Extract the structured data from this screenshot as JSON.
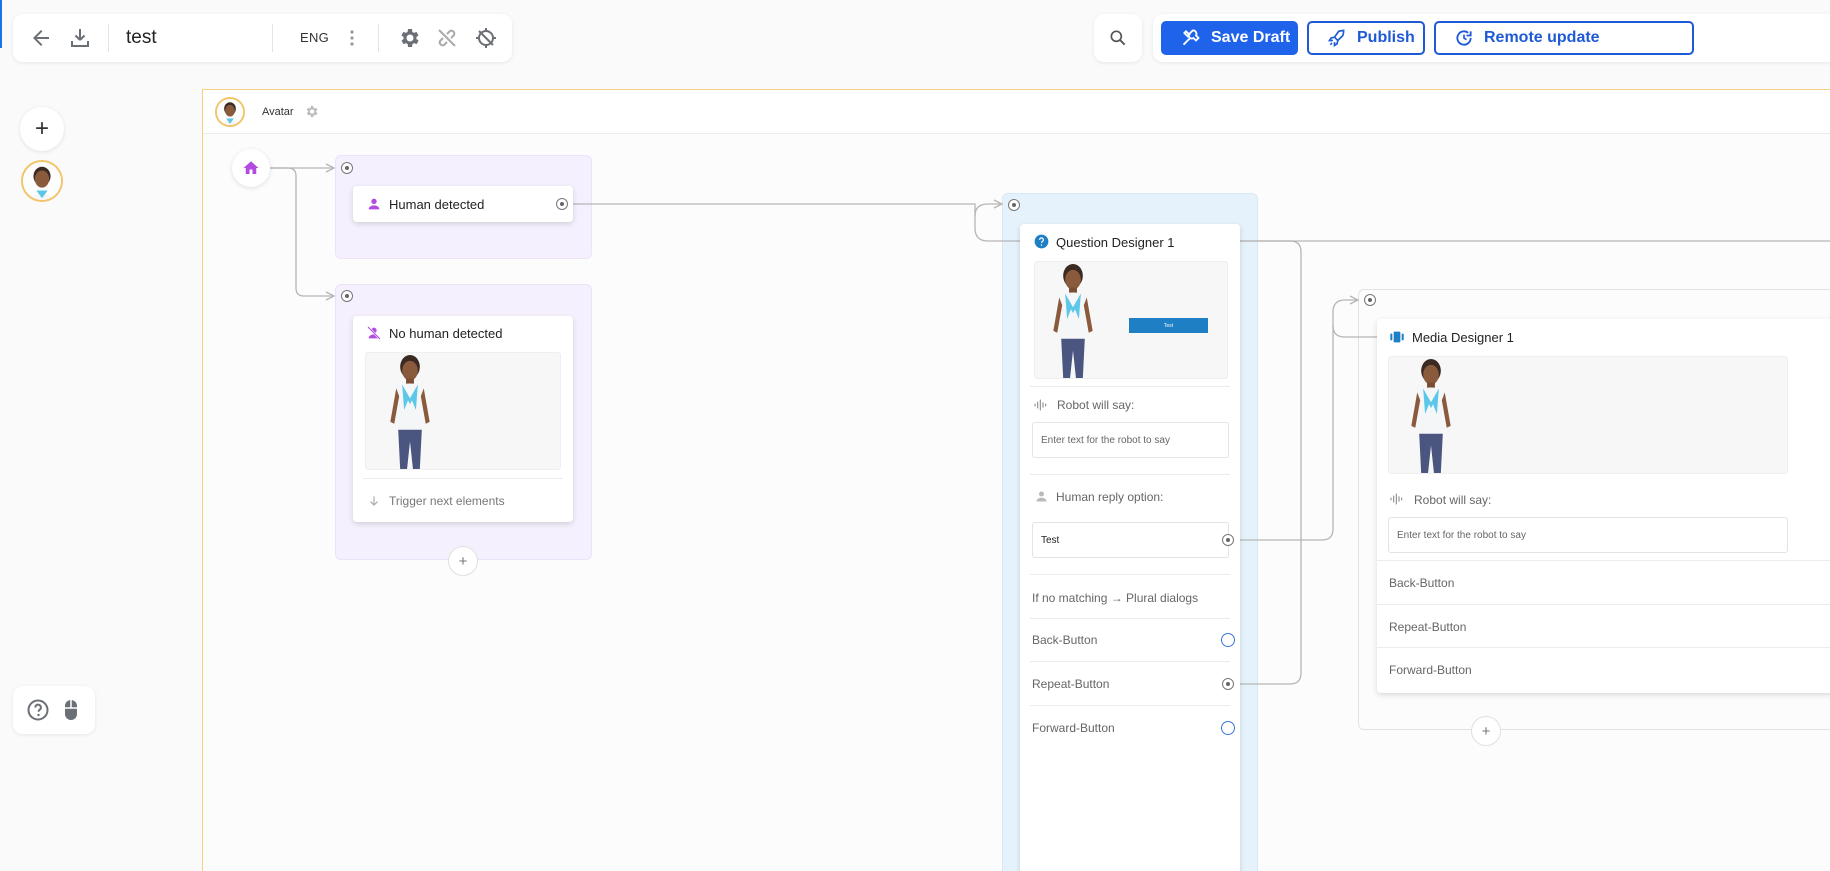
{
  "toolbar": {
    "title": "test",
    "language": "ENG",
    "search_icon": "search-icon",
    "save_label": "Save Draft",
    "publish_label": "Publish",
    "remote_label": "Remote update"
  },
  "frame": {
    "title": "Avatar"
  },
  "nodes": {
    "human_detected": {
      "title": "Human detected"
    },
    "no_human_detected": {
      "title": "No human detected",
      "trigger_label": "Trigger next elements"
    },
    "question_designer": {
      "title": "Question Designer 1",
      "preview_button": "Test",
      "robot_say_label": "Robot will say:",
      "robot_say_placeholder": "Enter text for the robot to say",
      "human_reply_label": "Human reply option:",
      "reply_option": "Test",
      "no_match_label": "If no matching → Plural dialogs",
      "back_button": "Back-Button",
      "repeat_button": "Repeat-Button",
      "forward_button": "Forward-Button"
    },
    "media_designer": {
      "title": "Media Designer 1",
      "robot_say_label": "Robot will say:",
      "robot_say_placeholder": "Enter text for the robot to say",
      "back_button": "Back-Button",
      "repeat_button": "Repeat-Button",
      "forward_button": "Forward-Button"
    }
  },
  "colors": {
    "primary": "#1f63ea",
    "group_purple": "#f5f0fd",
    "group_blue": "#e5f2fb",
    "accent_purple": "#b44be1"
  }
}
